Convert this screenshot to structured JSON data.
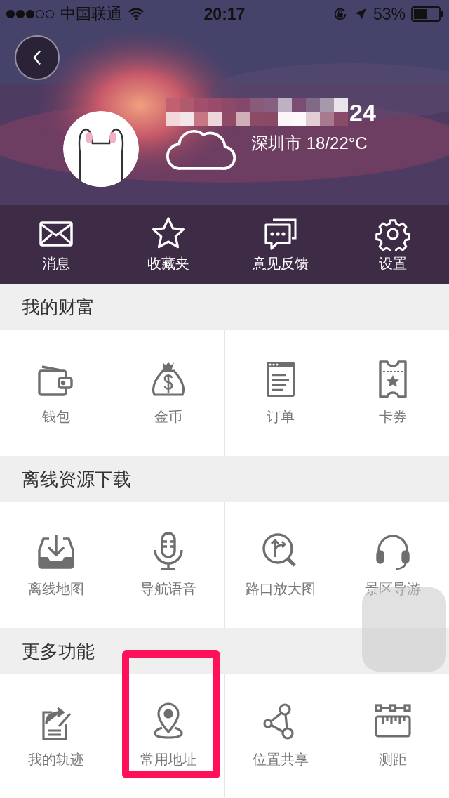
{
  "status_bar": {
    "carrier": "中国联通",
    "time": "20:17",
    "battery": "53%"
  },
  "profile": {
    "name_suffix": "24",
    "weather": "深圳市 18/22°C"
  },
  "quick_actions": [
    {
      "label": "消息"
    },
    {
      "label": "收藏夹"
    },
    {
      "label": "意见反馈"
    },
    {
      "label": "设置"
    }
  ],
  "sections": [
    {
      "title": "我的财富",
      "items": [
        {
          "label": "钱包",
          "highlighted": false
        },
        {
          "label": "金币",
          "highlighted": false
        },
        {
          "label": "订单",
          "highlighted": false
        },
        {
          "label": "卡券",
          "highlighted": false
        }
      ]
    },
    {
      "title": "离线资源下载",
      "items": [
        {
          "label": "离线地图",
          "highlighted": false
        },
        {
          "label": "导航语音",
          "highlighted": false
        },
        {
          "label": "路口放大图",
          "highlighted": false
        },
        {
          "label": "景区导游",
          "highlighted": false
        }
      ]
    },
    {
      "title": "更多功能",
      "items": [
        {
          "label": "我的轨迹",
          "highlighted": false
        },
        {
          "label": "常用地址",
          "highlighted": true
        },
        {
          "label": "位置共享",
          "highlighted": false
        },
        {
          "label": "测距",
          "highlighted": false
        }
      ]
    }
  ]
}
